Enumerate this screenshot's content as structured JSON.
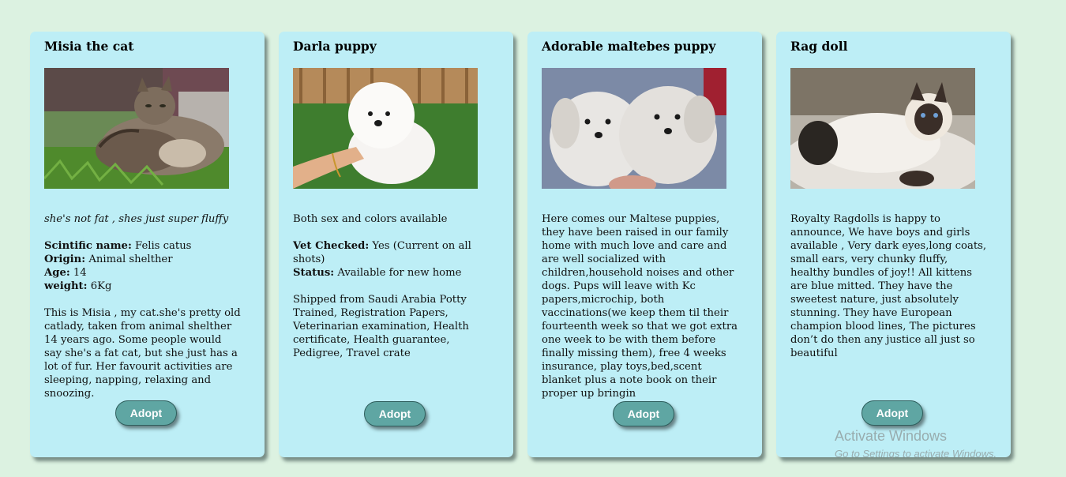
{
  "cards": [
    {
      "title": "Misia the cat",
      "tagline": "she's not fat , shes just super fluffy",
      "fields": [
        {
          "label": "Scintific name:",
          "value": "Felis catus"
        },
        {
          "label": "Origin:",
          "value": "Animal shelther"
        },
        {
          "label": "Age:",
          "value": "14"
        },
        {
          "label": "weight:",
          "value": "6Kg"
        }
      ],
      "description": "This is Misia , my cat.she's pretty old catlady, taken from animal shelther 14 years ago. Some people would say she's a fat cat, but she just has a lot of fur. Her favourit activities are sleeping, napping, relaxing and snoozing.",
      "button": "Adopt",
      "image_icon": "tabby-cat-photo"
    },
    {
      "title": "Darla puppy",
      "tagline": "Both sex and colors available",
      "fields": [
        {
          "label": "Vet Checked:",
          "value": "Yes (Current on all shots)"
        },
        {
          "label": "Status:",
          "value": "Available for new home"
        }
      ],
      "description": "Shipped from Saudi Arabia Potty Trained, Registration Papers, Veterinarian examination, Health certificate, Health guarantee, Pedigree, Travel crate",
      "button": "Adopt",
      "image_icon": "white-puppy-photo"
    },
    {
      "title": "Adorable maltebes puppy",
      "description": "Here comes our Maltese puppies, they have been raised in our family home with much love and care and are well socialized with children,household noises and other dogs. Pups will leave with Kc papers,microchip, both vaccinations(we keep them til their fourteenth week so that we got extra one week to be with them before finally missing them), free 4 weeks insurance, play toys,bed,scent blanket plus a note book on their proper up bringin",
      "button": "Adopt",
      "image_icon": "maltese-puppies-photo"
    },
    {
      "title": "Rag doll",
      "description": "Royalty Ragdolls is happy to announce, We have boys and girls available , Very dark eyes,long coats, small ears, very chunky fluffy, healthy bundles of joy!! All kittens are blue mitted. They have the sweetest nature, just absolutely stunning. They have European champion blood lines, The pictures don’t do then any justice all just so beautiful",
      "button": "Adopt",
      "image_icon": "ragdoll-cat-photo"
    }
  ],
  "watermark": {
    "title": "Activate Windows",
    "subtitle": "Go to Settings to activate Windows."
  },
  "colors": {
    "background": "#dcf2e1",
    "card": "#bdeef6",
    "button": "#5fa6a3"
  }
}
